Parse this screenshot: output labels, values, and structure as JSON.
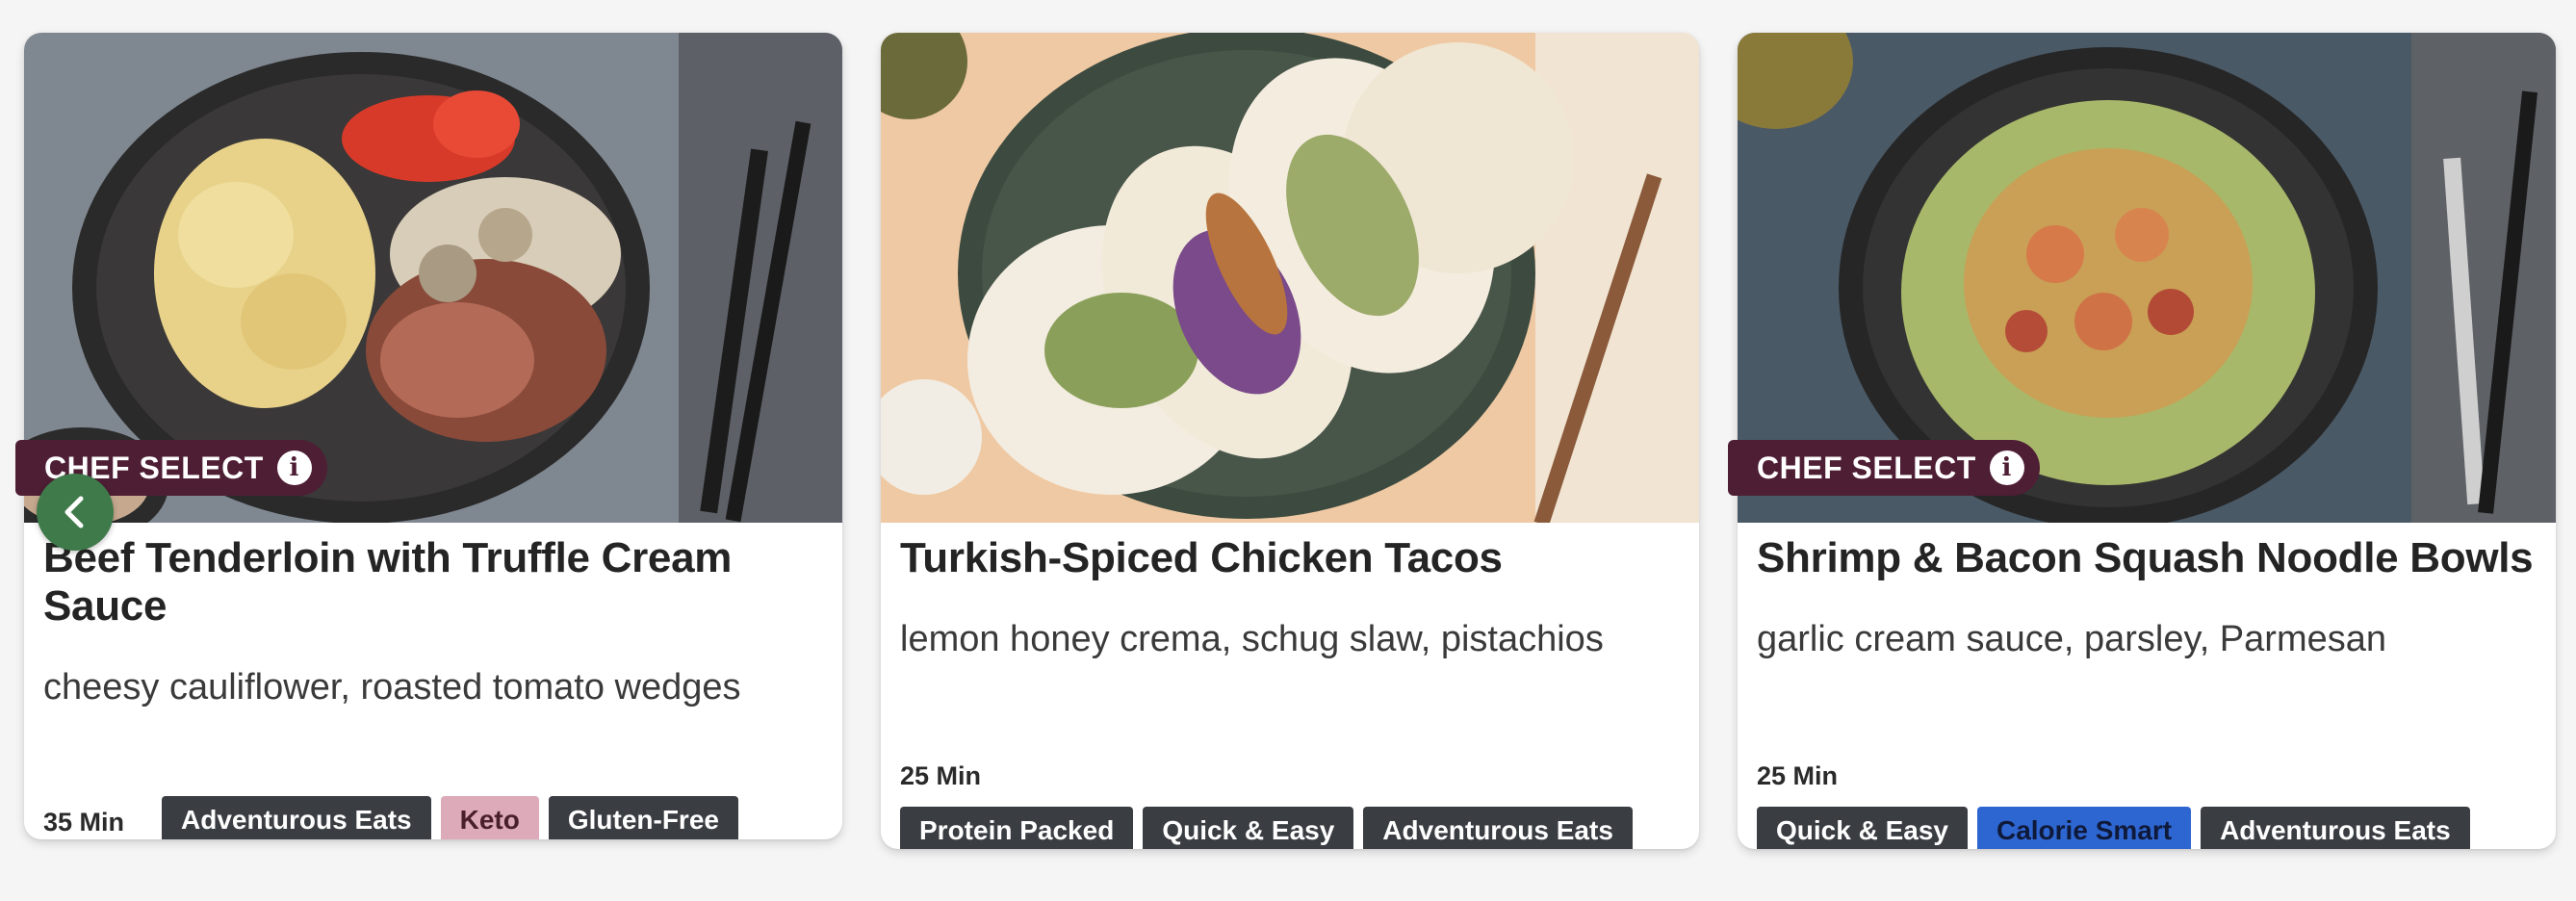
{
  "cards": [
    {
      "title": "Beef Tenderloin with Truffle Cream Sauce",
      "subtitle": "cheesy cauliflower, roasted tomato wedges",
      "time": "35 Min",
      "badge": "CHEF SELECT",
      "tags": [
        "Adventurous Eats",
        "Keto",
        "Gluten-Free"
      ]
    },
    {
      "title": "Turkish-Spiced Chicken Tacos",
      "subtitle": "lemon honey crema, schug slaw, pistachios",
      "time": "25 Min",
      "tags": [
        "Protein Packed",
        "Quick & Easy",
        "Adventurous Eats"
      ]
    },
    {
      "title": "Shrimp & Bacon Squash Noodle Bowls",
      "subtitle": "garlic cream sauce, parsley, Parmesan",
      "time": "25 Min",
      "badge": "CHEF SELECT",
      "tags": [
        "Quick & Easy",
        "Calorie Smart",
        "Adventurous Eats"
      ]
    }
  ],
  "icons": {
    "info": "info-icon",
    "prev": "chevron-left-icon"
  },
  "colors": {
    "badge": "#4e1e34",
    "arrow": "#3f7a4a",
    "tag_default": "#3a3d42",
    "tag_keto": "#dcaab8",
    "tag_calorie_smart": "#2e66d1"
  }
}
